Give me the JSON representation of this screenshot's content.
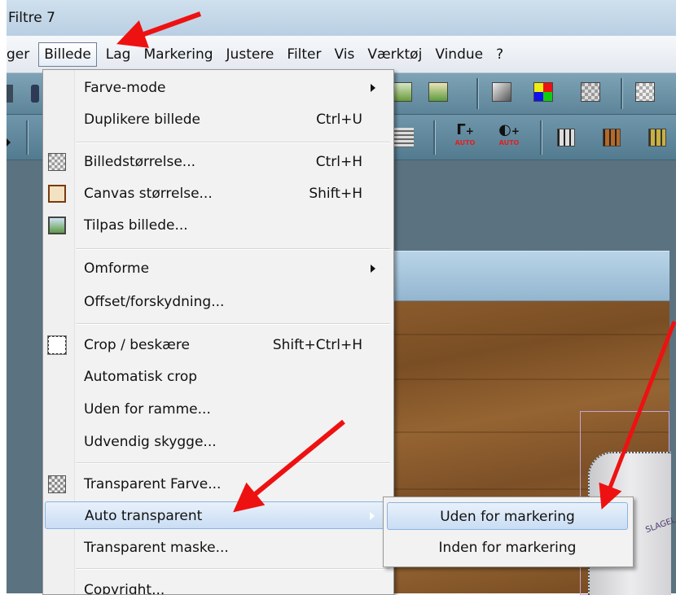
{
  "window": {
    "title": "Filtre 7"
  },
  "menubar": [
    {
      "label": "ger",
      "active": false
    },
    {
      "label": "Billede",
      "active": true
    },
    {
      "label": "Lag",
      "active": false
    },
    {
      "label": "Markering",
      "active": false
    },
    {
      "label": "Justere",
      "active": false
    },
    {
      "label": "Filter",
      "active": false
    },
    {
      "label": "Vis",
      "active": false
    },
    {
      "label": "Værktøj",
      "active": false
    },
    {
      "label": "Vindue",
      "active": false
    },
    {
      "label": "?",
      "active": false
    }
  ],
  "toolbar": {
    "auto_label": "AUTO"
  },
  "menu": {
    "items": [
      {
        "label": "Farve-mode",
        "shortcut": "",
        "submenu": true
      },
      {
        "label": "Duplikere billede",
        "shortcut": "Ctrl+U"
      },
      {
        "label": "Billedstørrelse...",
        "shortcut": "Ctrl+H",
        "icon": "image-size-icon"
      },
      {
        "label": "Canvas størrelse...",
        "shortcut": "Shift+H",
        "icon": "canvas-size-icon"
      },
      {
        "label": "Tilpas billede...",
        "shortcut": "",
        "icon": "fit-image-icon"
      },
      {
        "label": "Omforme",
        "shortcut": "",
        "submenu": true
      },
      {
        "label": "Offset/forskydning...",
        "shortcut": ""
      },
      {
        "label": "Crop / beskære",
        "shortcut": "Shift+Ctrl+H",
        "icon": "crop-icon"
      },
      {
        "label": "Automatisk crop",
        "shortcut": ""
      },
      {
        "label": "Uden for ramme...",
        "shortcut": ""
      },
      {
        "label": "Udvendig skygge...",
        "shortcut": ""
      },
      {
        "label": "Transparent Farve...",
        "shortcut": "",
        "icon": "transparent-color-icon"
      },
      {
        "label": "Auto transparent",
        "shortcut": "",
        "submenu": true,
        "highlighted": true
      },
      {
        "label": "Transparent maske...",
        "shortcut": ""
      },
      {
        "label": "Copyright...",
        "shortcut": ""
      }
    ]
  },
  "submenu": {
    "items": [
      {
        "label": "Uden for markering",
        "highlighted": true
      },
      {
        "label": "Inden for markering"
      }
    ]
  },
  "canvas": {
    "cup_text": "SLAGEL"
  },
  "colors": {
    "annotation_arrow": "#ee1111",
    "highlight_border": "#8bb3e2"
  }
}
